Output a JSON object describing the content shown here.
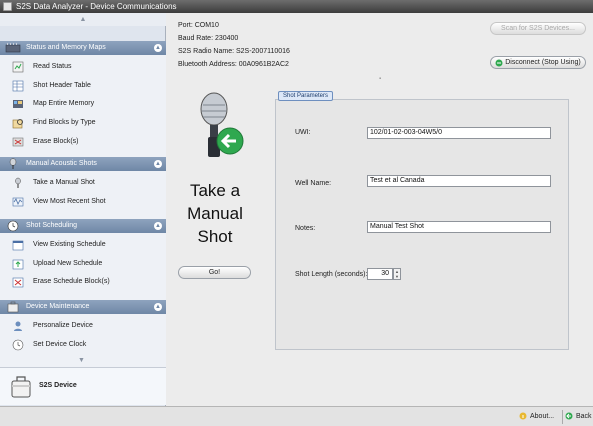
{
  "window": {
    "title": "S2S Data Analyzer - Device Communications"
  },
  "sidebar": {
    "scroll_up": "▲",
    "scroll_down": "▼",
    "sections": [
      {
        "header": "Status and Memory Maps",
        "items": [
          "Read Status",
          "Shot Header Table",
          "Map Entire Memory",
          "Find Blocks by Type",
          "Erase Block(s)"
        ]
      },
      {
        "header": "Manual Acoustic Shots",
        "items": [
          "Take a Manual Shot",
          "View Most Recent Shot"
        ]
      },
      {
        "header": "Shot Scheduling",
        "items": [
          "View Existing Schedule",
          "Upload New Schedule",
          "Erase Schedule Block(s)"
        ]
      },
      {
        "header": "Device Maintenance",
        "items": [
          "Personalize Device",
          "Set Device Clock"
        ]
      }
    ],
    "device_label": "S2S Device"
  },
  "main": {
    "port": "Port: COM10",
    "baud_rate": "Baud Rate: 230400",
    "radio_name": "S2S Radio Name: S2S-2007110016",
    "bluetooth": "Bluetooth Address: 00A0961B2AC2",
    "scan_button": "Scan for S2S Devices...",
    "disconnect_button": "Disconnect (Stop Using)",
    "big_title_line1": "Take a",
    "big_title_line2": "Manual",
    "big_title_line3": "Shot",
    "go_button": "Go!",
    "tab_label": "Shot Parameters",
    "fields": {
      "uwi_label": "UWI:",
      "uwi_value": "102/01-02-003-04W5/0",
      "well_label": "Well Name:",
      "well_value": "Test et al Canada",
      "notes_label": "Notes:",
      "notes_value": "Manual Test Shot",
      "shot_length_label": "Shot Length (seconds):",
      "shot_length_value": "30"
    }
  },
  "statusbar": {
    "about": "About...",
    "back": "Back"
  },
  "colors": {
    "sidebar_header": "#7890ad",
    "tab_border": "#6e8fbf",
    "accent_green": "#2fa84f"
  }
}
